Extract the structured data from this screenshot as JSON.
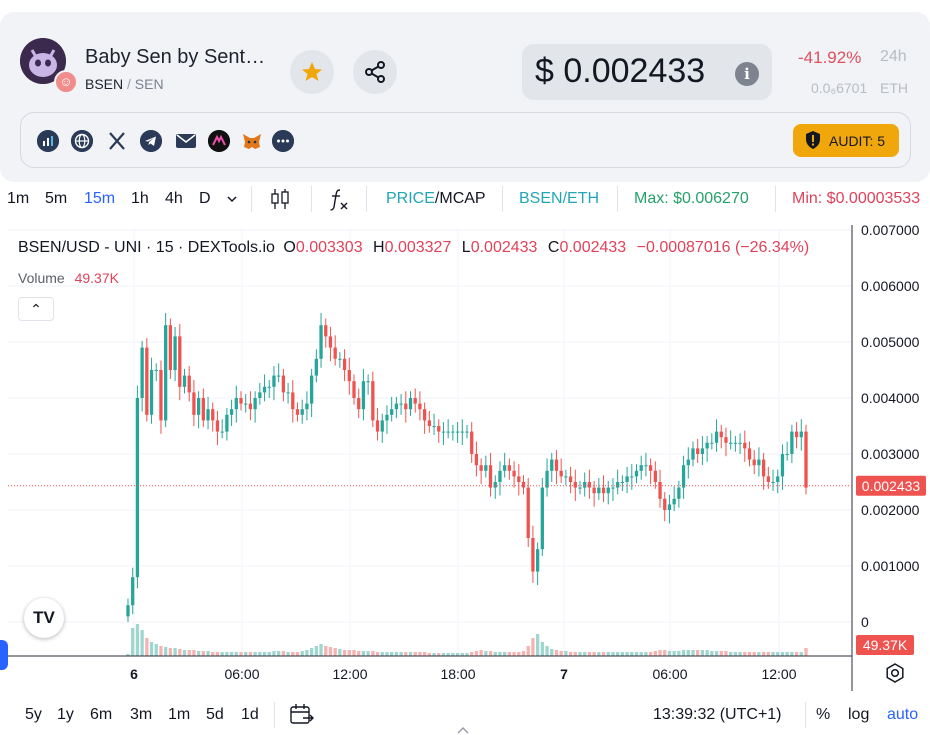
{
  "token": {
    "name": "Baby Sen by Sent…",
    "symbol": "BSEN",
    "separator": "/",
    "quote": "SEN",
    "price": "$ 0.002433",
    "change": "-41.92%",
    "change_period": "24h",
    "eth_price": "0.0₆6701",
    "eth_unit": "ETH"
  },
  "social_icons": [
    "dextools-icon",
    "globe-icon",
    "x-icon",
    "telegram-icon",
    "mail-icon",
    "coin-icon",
    "metamask-icon",
    "more-icon"
  ],
  "audit": {
    "label": "AUDIT: 5",
    "color": "#f0a70b"
  },
  "toolbar": {
    "timeframes": [
      "1m",
      "5m",
      "15m",
      "1h",
      "4h",
      "D"
    ],
    "active_timeframe": "15m",
    "price_label": "PRICE",
    "slash": "/",
    "mcap_label": "MCAP",
    "pair_label": "BSEN/ETH",
    "max_label": "Max: $0.006270",
    "min_label": "Min: $0.00003533"
  },
  "legend": {
    "symbol": "BSEN/USD - UNI · 15 · DEXTools.io",
    "o_key": "O",
    "o_val": "0.003303",
    "h_key": "H",
    "h_val": "0.003327",
    "l_key": "L",
    "l_val": "0.002433",
    "c_key": "C",
    "c_val": "0.002433",
    "change": "−0.00087016 (−26.34%)",
    "volume_label": "Volume",
    "volume_value": "49.37K",
    "collapse_glyph": "⌃"
  },
  "colors": {
    "up": "#26a69a",
    "down": "#ef5350",
    "up_vol": "#9fd6d0",
    "down_vol": "#f5b3b1",
    "accent": "#2962ff"
  },
  "chart_data": {
    "type": "candlestick",
    "title": "BSEN/USD - UNI · 15 · DEXTools.io",
    "ylim": [
      0,
      0.007
    ],
    "y_ticks": [
      "0.007000",
      "0.006000",
      "0.005000",
      "0.004000",
      "0.003000",
      "0.002000",
      "0.001000",
      "0"
    ],
    "y_tick_values": [
      0.007,
      0.006,
      0.005,
      0.004,
      0.003,
      0.002,
      0.001,
      0
    ],
    "x_ticks": [
      "6",
      "06:00",
      "12:00",
      "18:00",
      "7",
      "06:00",
      "12:00"
    ],
    "last_price_label": "0.002433",
    "last_price": 0.002433,
    "volume_label": "49.37K",
    "closes": [
      0.0003,
      0.0008,
      0.004,
      0.0049,
      0.0037,
      0.0045,
      0.0045,
      0.0036,
      0.0053,
      0.0045,
      0.0051,
      0.0042,
      0.0044,
      0.0041,
      0.0037,
      0.004,
      0.0036,
      0.0038,
      0.0036,
      0.0034,
      0.0034,
      0.0037,
      0.0038,
      0.004,
      0.0039,
      0.0039,
      0.0038,
      0.004,
      0.0041,
      0.0042,
      0.0042,
      0.0044,
      0.0044,
      0.0041,
      0.0041,
      0.0038,
      0.0037,
      0.0038,
      0.0039,
      0.0044,
      0.0047,
      0.0053,
      0.0051,
      0.0049,
      0.0047,
      0.0047,
      0.0045,
      0.0043,
      0.004,
      0.0038,
      0.0043,
      0.0043,
      0.0036,
      0.0034,
      0.0036,
      0.0037,
      0.0038,
      0.0039,
      0.0039,
      0.0038,
      0.004,
      0.0039,
      0.0038,
      0.0036,
      0.0035,
      0.0035,
      0.0034,
      0.0034,
      0.0034,
      0.0034,
      0.0034,
      0.0034,
      0.0034,
      0.003,
      0.0028,
      0.0027,
      0.0028,
      0.0024,
      0.0025,
      0.0027,
      0.0028,
      0.0027,
      0.0026,
      0.0025,
      0.0024,
      0.0015,
      0.0009,
      0.0013,
      0.0024,
      0.0027,
      0.0029,
      0.0027,
      0.0026,
      0.0026,
      0.0025,
      0.0024,
      0.0024,
      0.0025,
      0.0024,
      0.0023,
      0.0024,
      0.0023,
      0.0024,
      0.0024,
      0.0025,
      0.0025,
      0.0026,
      0.0026,
      0.0027,
      0.0028,
      0.0028,
      0.0027,
      0.0025,
      0.0022,
      0.002,
      0.0021,
      0.0022,
      0.0024,
      0.0028,
      0.0029,
      0.0031,
      0.003,
      0.0031,
      0.0032,
      0.0032,
      0.0034,
      0.0033,
      0.0032,
      0.0032,
      0.0032,
      0.0032,
      0.0031,
      0.0029,
      0.0028,
      0.0029,
      0.0026,
      0.0025,
      0.0025,
      0.0026,
      0.003,
      0.003,
      0.0034,
      0.0033,
      0.0034,
      0.0024
    ]
  },
  "bottom": {
    "ranges": [
      "5y",
      "1y",
      "6m",
      "3m",
      "1m",
      "5d",
      "1d"
    ],
    "clock": "13:39:32 (UTC+1)",
    "pct": "%",
    "log": "log",
    "auto": "auto"
  }
}
